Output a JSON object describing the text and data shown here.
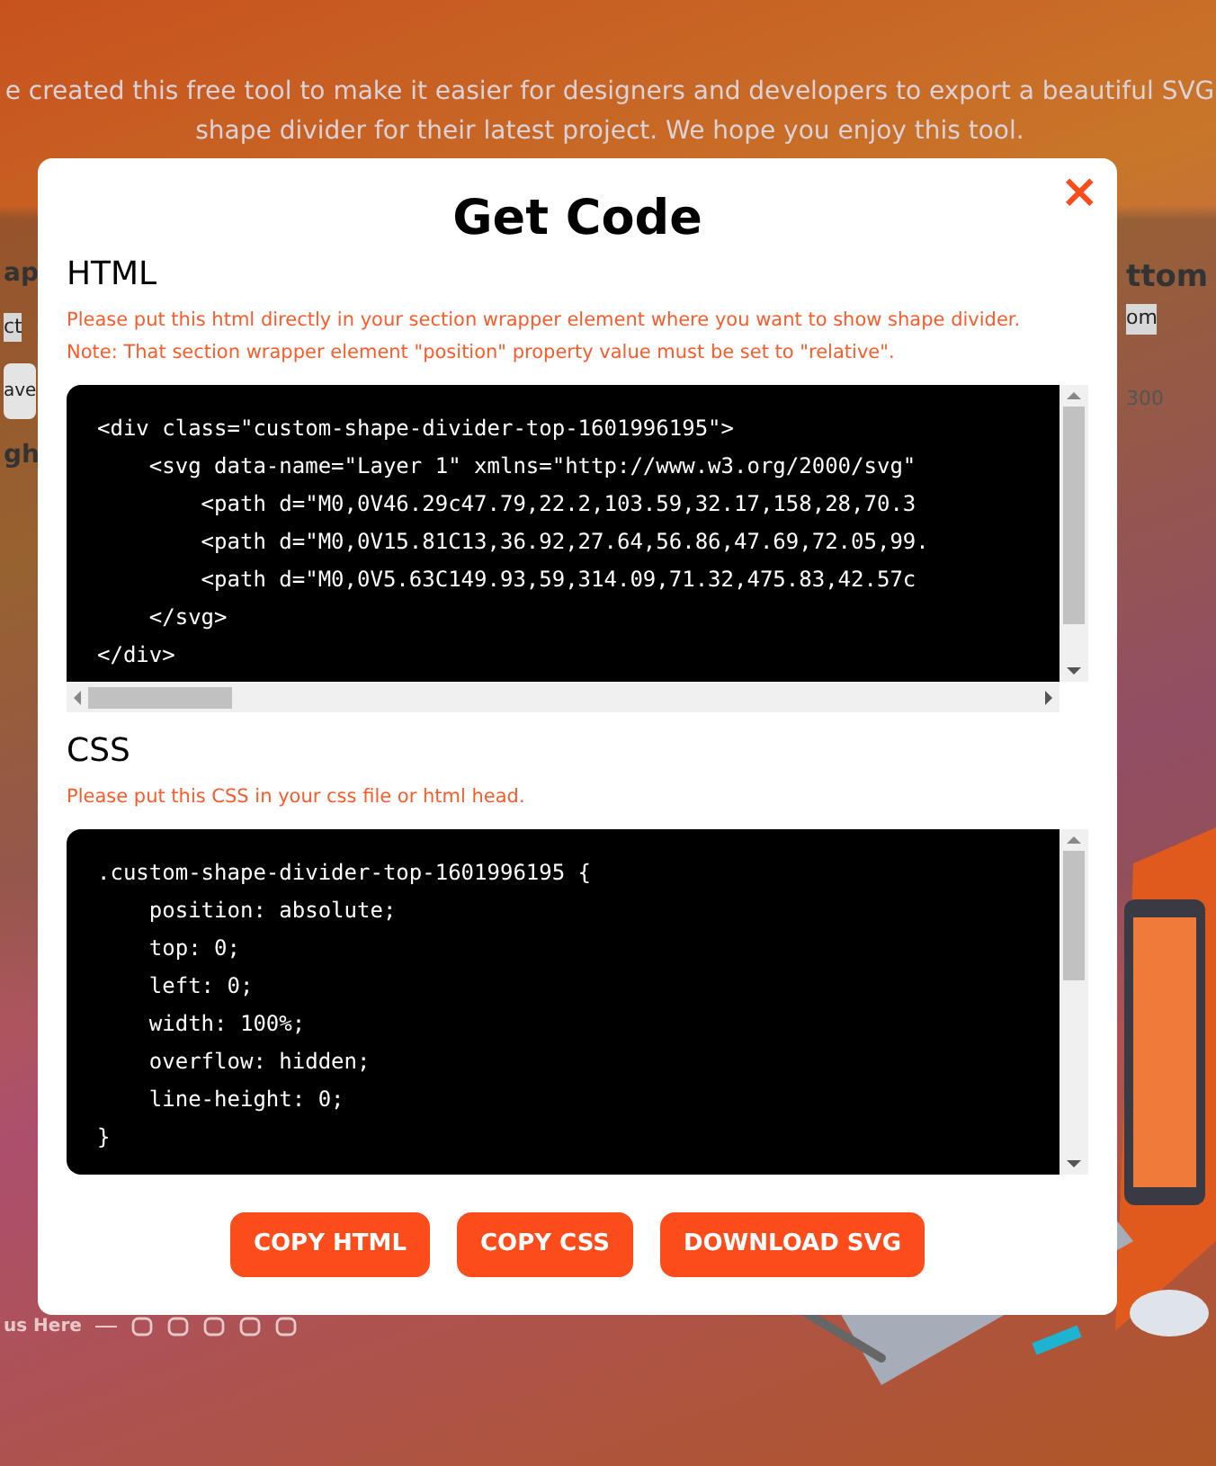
{
  "page": {
    "intro_lines": [
      "e created this free tool to make it easier for designers and developers to export a beautiful SVG",
      "shape divider for their latest project. We hope you enjoy this tool."
    ],
    "left_fragments": [
      {
        "kind": "heading",
        "text": "ap"
      },
      {
        "kind": "sub",
        "text": "ct"
      },
      {
        "kind": "field",
        "text": "ave"
      },
      {
        "kind": "heading",
        "text": "gh"
      }
    ],
    "right_fragments": [
      {
        "kind": "heading",
        "text": "ttom"
      },
      {
        "kind": "sub",
        "text": "om"
      },
      {
        "kind": "tick",
        "text": "300"
      }
    ],
    "footer_label": "us Here"
  },
  "modal": {
    "title": "Get Code",
    "close": "×",
    "sections": [
      {
        "heading": "HTML",
        "notes": [
          "Please put this html directly in your section wrapper element where you want to show shape divider.",
          "Note: That section wrapper element \"position\" property value must be set to \"relative\"."
        ],
        "horizontal_scroll": true,
        "code": [
          "<div class=\"custom-shape-divider-top-1601996195\">",
          "    <svg data-name=\"Layer 1\" xmlns=\"http://www.w3.org/2000/svg\"",
          "        <path d=\"M0,0V46.29c47.79,22.2,103.59,32.17,158,28,70.3",
          "        <path d=\"M0,0V15.81C13,36.92,27.64,56.86,47.69,72.05,99.",
          "        <path d=\"M0,0V5.63C149.93,59,314.09,71.32,475.83,42.57c",
          "    </svg>",
          "</div>"
        ]
      },
      {
        "heading": "CSS",
        "notes": [
          "Please put this CSS in your css file or html head."
        ],
        "horizontal_scroll": false,
        "code": [
          ".custom-shape-divider-top-1601996195 {",
          "    position: absolute;",
          "    top: 0;",
          "    left: 0;",
          "    width: 100%;",
          "    overflow: hidden;",
          "    line-height: 0;",
          "}"
        ]
      }
    ],
    "buttons": [
      "COPY HTML",
      "COPY CSS",
      "DOWNLOAD SVG"
    ]
  }
}
